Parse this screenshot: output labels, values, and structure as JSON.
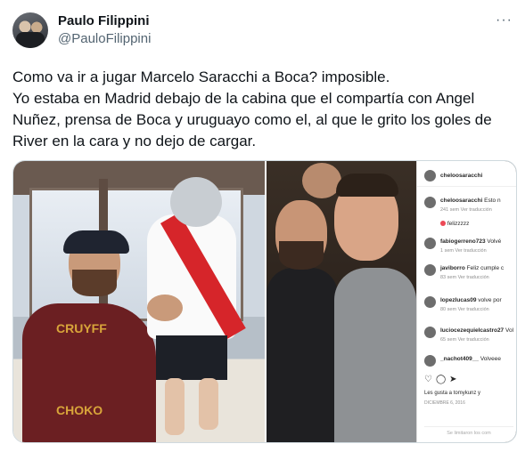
{
  "tweet": {
    "display_name": "Paulo Filippini",
    "handle": "@PauloFilippini",
    "more_glyph": "···",
    "text_lines": [
      "Como va ir a jugar Marcelo Saracchi a Boca? imposible.",
      "Yo estaba en Madrid debajo de la cabina que el compartía con Angel Nuñez, prensa de Boca y uruguayo como el, al que le grito los goles de River en la cara y no dejo de cargar."
    ]
  },
  "media": {
    "left_photo": {
      "shirt_text_top": "CRUYFF",
      "shirt_text_bottom": "CHOKO"
    },
    "instagram": {
      "post_user": "cheloosaracchi",
      "comments": [
        {
          "user": "cheloosaracchi",
          "text": "Esto n",
          "meta": "241 sem   Ver traducción"
        },
        {
          "user": "",
          "text": "felizzzzz",
          "meta": ""
        },
        {
          "user": "fabiogerreno723",
          "text": "Volvé",
          "meta": "1 sem   Ver traducción"
        },
        {
          "user": "javiborro",
          "text": "Feliz cumple c",
          "meta": "83 sem   Ver traducción"
        },
        {
          "user": "lopezlucas09",
          "text": "volve por",
          "meta": "80 sem   Ver traducción"
        },
        {
          "user": "luciocezequielcastro27",
          "text": "Vol",
          "meta": "65 sem   Ver traducción"
        },
        {
          "user": "_nachot409__",
          "text": "Volveee",
          "meta": ""
        }
      ],
      "likes": "Les gusta a tomykunz y",
      "date": "DICIEMBRE 6, 2016",
      "footer": "Se limitaron los com"
    }
  }
}
